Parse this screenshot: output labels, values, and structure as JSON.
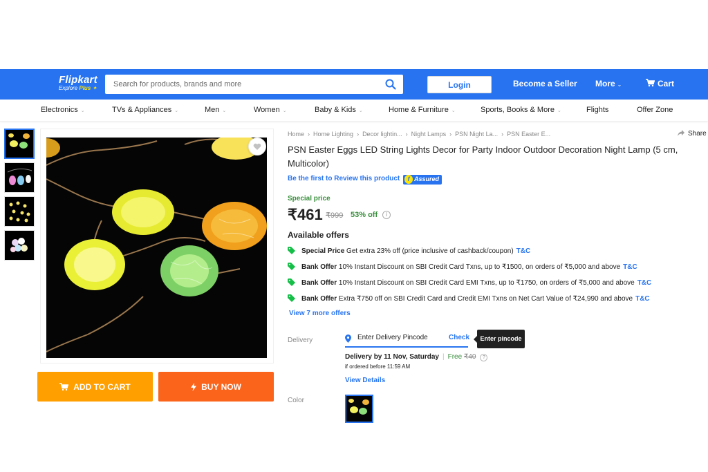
{
  "header": {
    "logo_text": "Flipkart",
    "logo_sub_prefix": "Explore",
    "logo_sub_plus": "Plus",
    "search_placeholder": "Search for products, brands and more",
    "login_label": "Login",
    "seller_label": "Become a Seller",
    "more_label": "More",
    "cart_label": "Cart",
    "brand_color": "#2874f0"
  },
  "categories": [
    "Electronics",
    "TVs & Appliances",
    "Men",
    "Women",
    "Baby & Kids",
    "Home & Furniture",
    "Sports, Books & More",
    "Flights",
    "Offer Zone"
  ],
  "gallery": {
    "add_to_cart_label": "ADD TO CART",
    "buy_now_label": "BUY NOW"
  },
  "product": {
    "breadcrumbs": [
      "Home",
      "Home Lighting",
      "Decor lightin...",
      "Night Lamps",
      "PSN Night La...",
      "PSN Easter E..."
    ],
    "share_label": "Share",
    "title": "PSN Easter Eggs LED String Lights Decor for Party Indoor Outdoor Decoration Night Lamp  (5 cm, Multicolor)",
    "review_link": "Be the first to Review this product",
    "assured_label": "Assured",
    "special_price_label": "Special price",
    "price": "₹461",
    "mrp": "₹999",
    "discount": "53% off"
  },
  "offers": {
    "heading": "Available offers",
    "items": [
      {
        "type": "Special Price",
        "text": "Get extra 23% off (price inclusive of cashback/coupon)",
        "tc": "T&C"
      },
      {
        "type": "Bank Offer",
        "text": "10% Instant Discount on SBI Credit Card Txns, up to ₹1500, on orders of ₹5,000 and above",
        "tc": "T&C"
      },
      {
        "type": "Bank Offer",
        "text": "10% Instant Discount on SBI Credit Card EMI Txns, up to ₹1750, on orders of ₹5,000 and above",
        "tc": "T&C"
      },
      {
        "type": "Bank Offer",
        "text": "Extra ₹750 off on SBI Credit Card and Credit EMI Txns on Net Cart Value of ₹24,990 and above",
        "tc": "T&C"
      }
    ],
    "more_link": "View 7 more offers"
  },
  "delivery": {
    "label": "Delivery",
    "pincode_placeholder": "Enter Delivery Pincode",
    "check_label": "Check",
    "tooltip": "Enter pincode",
    "delivery_by": "Delivery by 11 Nov, Saturday",
    "free_label": "Free",
    "free_strike": "₹40",
    "ordered_before": "if ordered before 11:59 AM",
    "view_details": "View Details"
  },
  "color": {
    "label": "Color"
  }
}
